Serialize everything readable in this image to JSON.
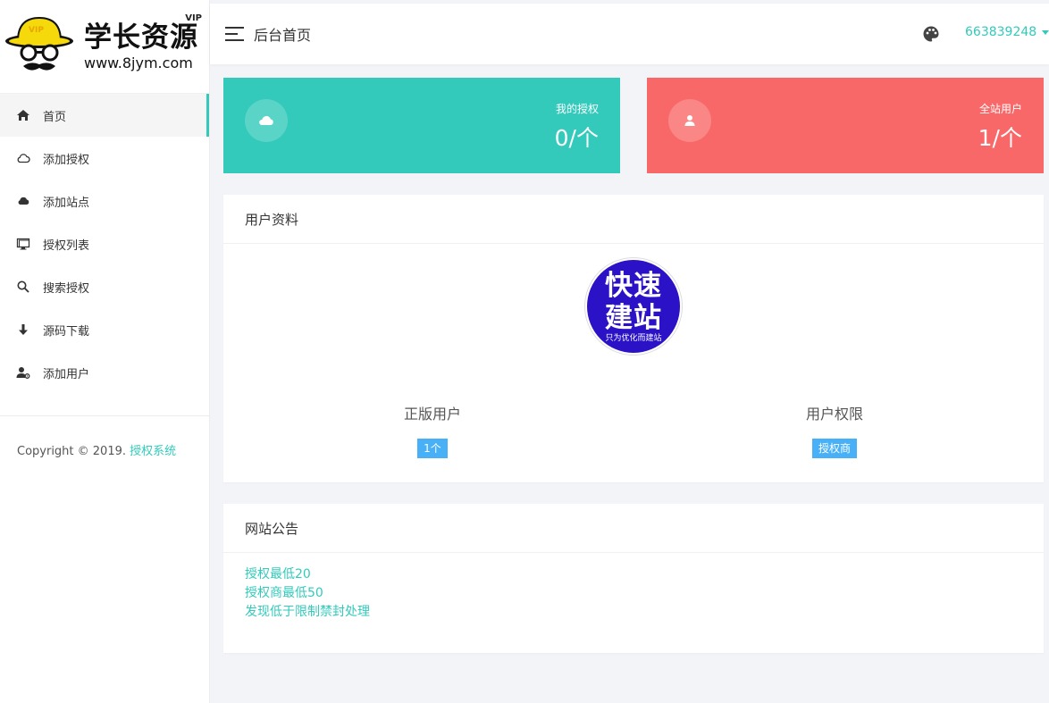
{
  "brand": {
    "title": "学长资源",
    "vip": "VIP",
    "url": "www.8jym.com"
  },
  "sidebar": {
    "items": [
      {
        "label": "首页",
        "icon": "home-icon",
        "active": true
      },
      {
        "label": "添加授权",
        "icon": "cloud-outline-icon"
      },
      {
        "label": "添加站点",
        "icon": "cloud-icon"
      },
      {
        "label": "授权列表",
        "icon": "monitor-icon"
      },
      {
        "label": "搜索授权",
        "icon": "search-icon"
      },
      {
        "label": "源码下载",
        "icon": "download-arrow-icon"
      },
      {
        "label": "添加用户",
        "icon": "user-settings-icon"
      }
    ],
    "copyright_text": "Copyright © 2019. ",
    "copyright_link": "授权系统"
  },
  "header": {
    "title": "后台首页",
    "username": "663839248"
  },
  "stats": {
    "my_auth_label": "我的授权",
    "my_auth_value": "0/个",
    "site_users_label": "全站用户",
    "site_users_value": "1/个"
  },
  "profile": {
    "title": "用户资料",
    "avatar_line1": "快速",
    "avatar_line2": "建站",
    "avatar_line3": "只为优化而建站",
    "genuine_label": "正版用户",
    "genuine_value": "1个",
    "perm_label": "用户权限",
    "perm_value": "授权商"
  },
  "notice": {
    "title": "网站公告",
    "lines": [
      "授权最低20",
      "授权商最低50",
      "发现低于限制禁封处理"
    ]
  },
  "colors": {
    "accent": "#33cabb",
    "danger": "#f96868",
    "info": "#48b0f7",
    "avatar_bg": "#2b12c7"
  }
}
